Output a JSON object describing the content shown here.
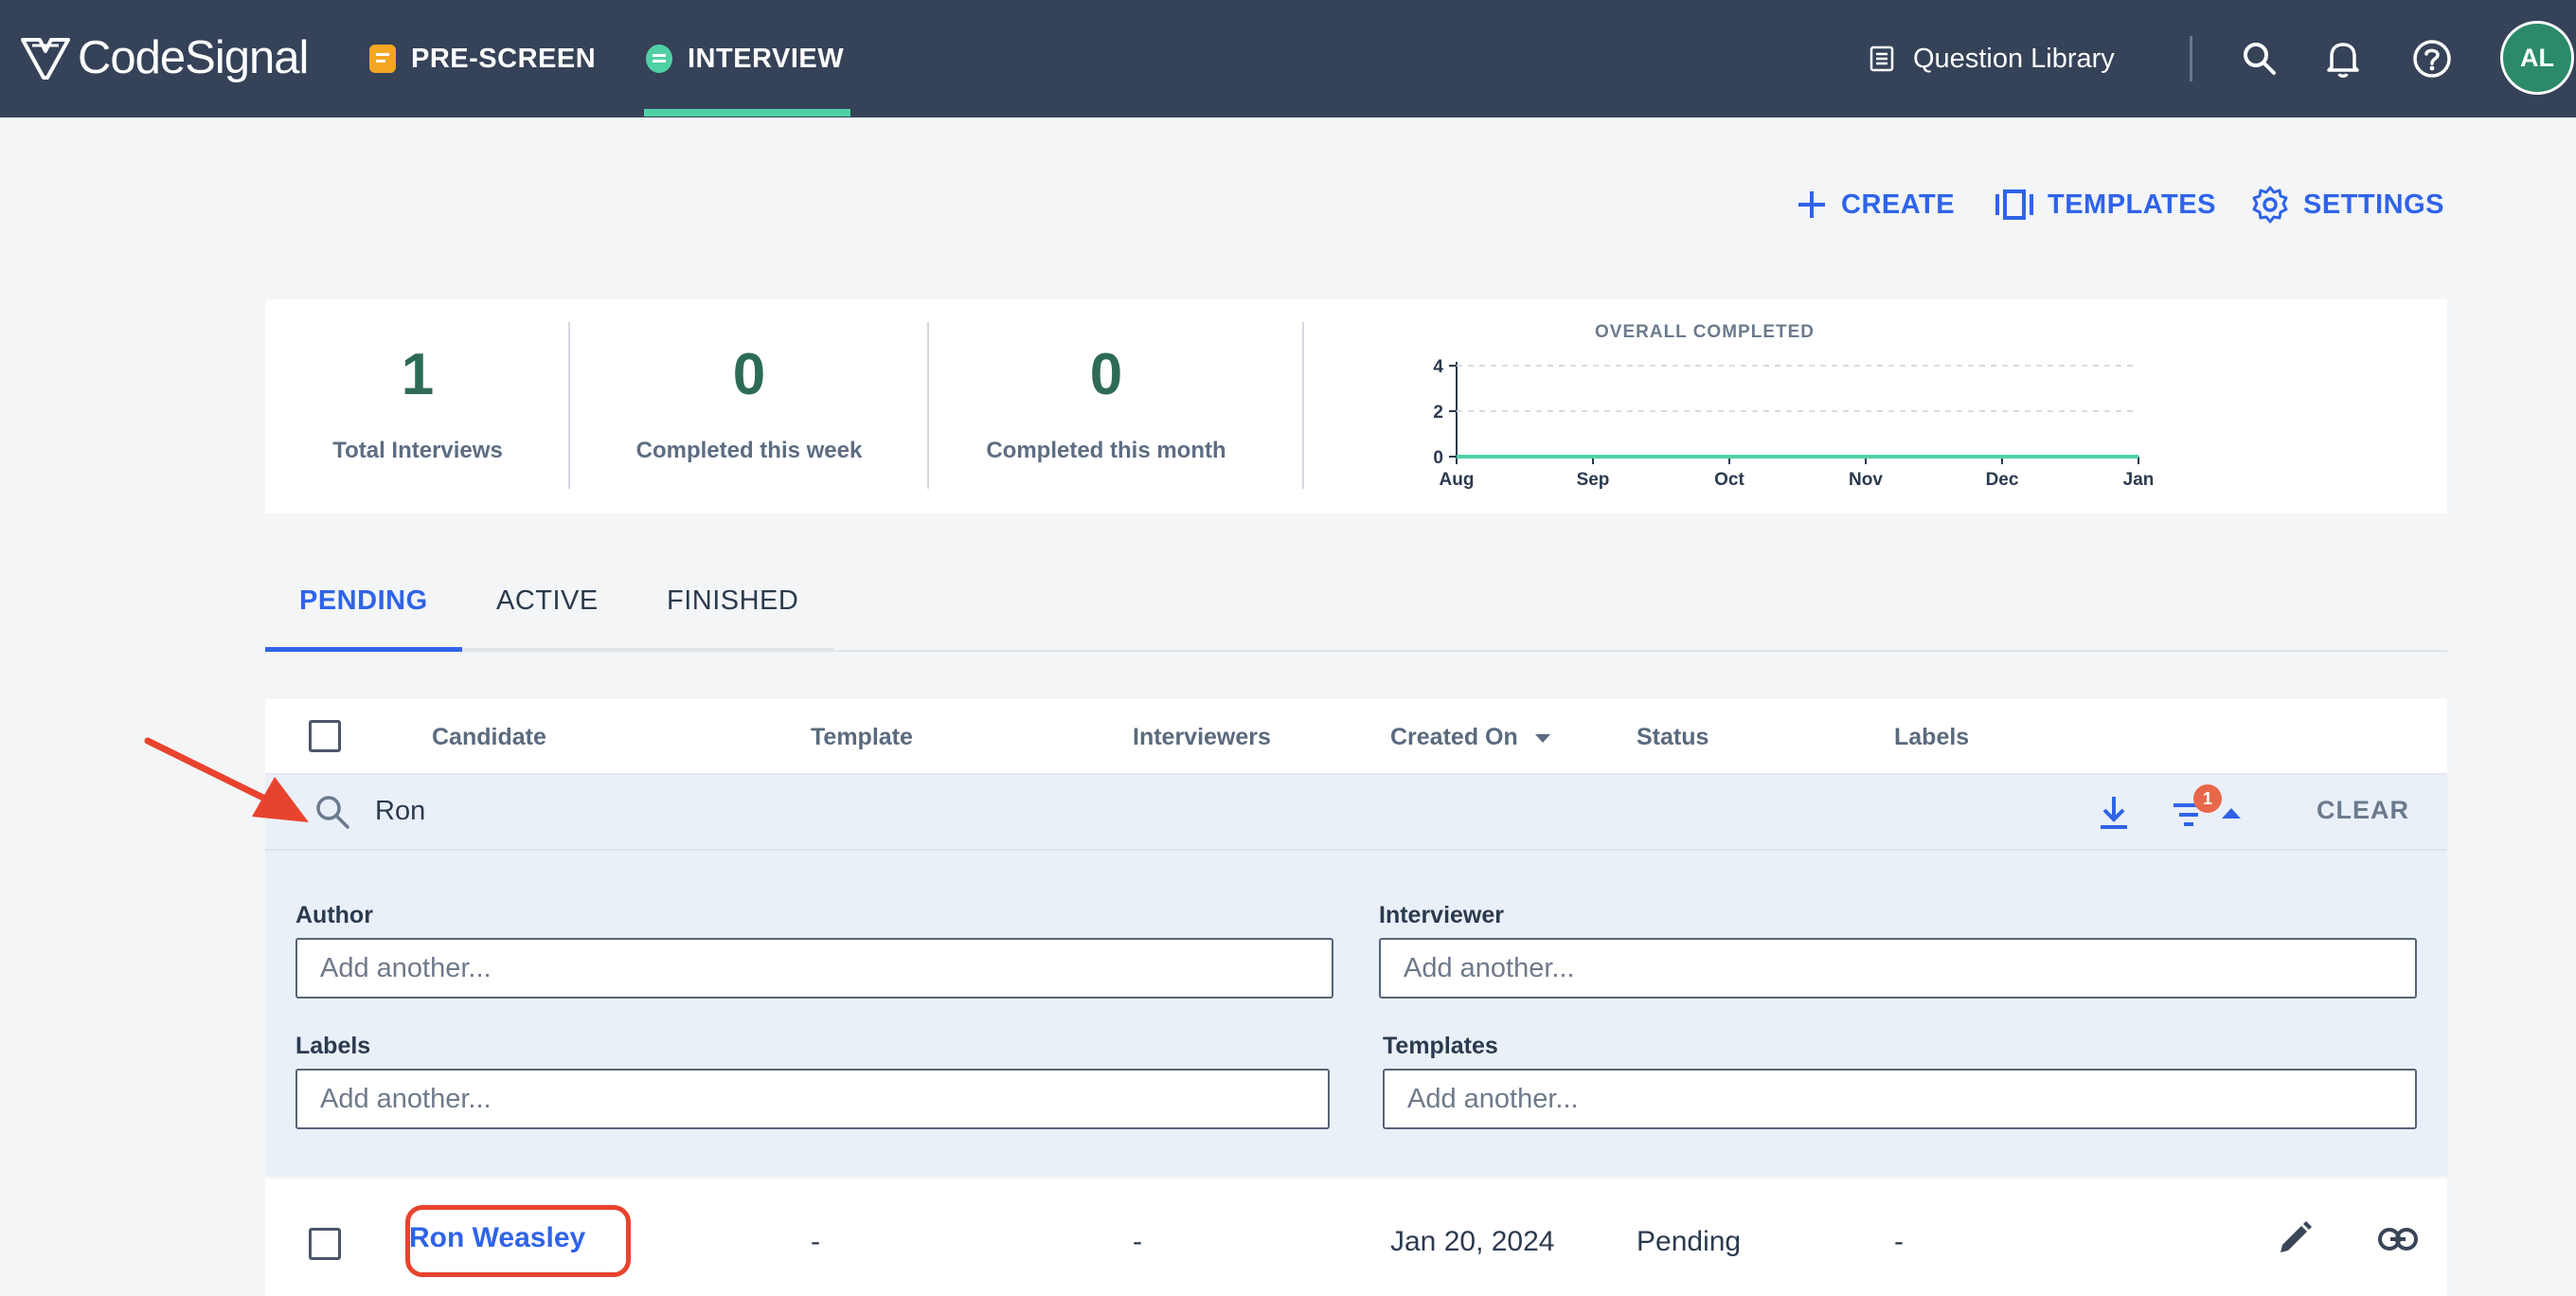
{
  "app": {
    "logo_text": "CodeSignal"
  },
  "nav": {
    "items": [
      {
        "label": "PRE-SCREEN",
        "icon": "prescreen-icon",
        "color": "#f5a623"
      },
      {
        "label": "INTERVIEW",
        "icon": "interview-icon",
        "color": "#4fd1a5",
        "active": true
      }
    ],
    "question_library": "Question Library",
    "avatar_initials": "AL"
  },
  "actions": {
    "create": "CREATE",
    "templates": "TEMPLATES",
    "settings": "SETTINGS"
  },
  "stats": [
    {
      "value": "1",
      "label": "Total Interviews"
    },
    {
      "value": "0",
      "label": "Completed this week"
    },
    {
      "value": "0",
      "label": "Completed this month"
    }
  ],
  "chart_data": {
    "type": "line",
    "title": "OVERALL COMPLETED",
    "categories": [
      "Aug",
      "Sep",
      "Oct",
      "Nov",
      "Dec",
      "Jan"
    ],
    "series": [
      {
        "values": [
          0,
          0,
          0,
          0,
          0,
          0
        ]
      }
    ],
    "y_ticks": [
      "4",
      "2",
      "0"
    ],
    "ylim": [
      0,
      4
    ],
    "grid": true,
    "line_color": "#4fd1a5"
  },
  "tabs": [
    "PENDING",
    "ACTIVE",
    "FINISHED"
  ],
  "table": {
    "columns": [
      "Candidate",
      "Template",
      "Interviewers",
      "Created On",
      "Status",
      "Labels"
    ],
    "sort_column": "Created On",
    "search_value": "Ron",
    "filter_count": "1",
    "clear_label": "CLEAR",
    "filters": {
      "author": {
        "label": "Author",
        "placeholder": "Add another..."
      },
      "interviewer": {
        "label": "Interviewer",
        "placeholder": "Add another..."
      },
      "labels": {
        "label": "Labels",
        "placeholder": "Add another..."
      },
      "templates": {
        "label": "Templates",
        "placeholder": "Add another..."
      }
    },
    "rows": [
      {
        "candidate": "Ron Weasley",
        "template": "-",
        "interviewers": "-",
        "created_on": "Jan 20, 2024",
        "status": "Pending",
        "labels": "-"
      }
    ]
  },
  "colors": {
    "accent": "#2f63e8",
    "header_bg": "#354258",
    "highlight": "#e8432e"
  }
}
